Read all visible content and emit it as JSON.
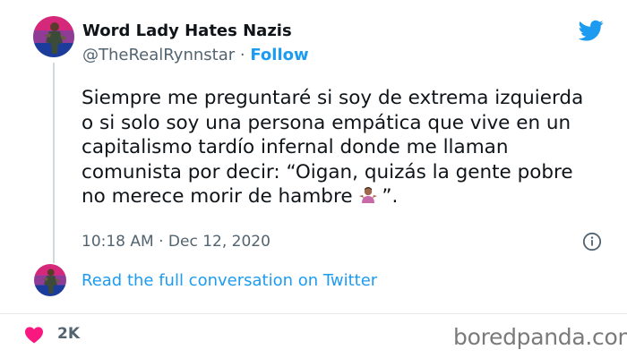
{
  "tweet": {
    "author_name": "Word Lady Hates Nazis",
    "handle": "@TheRealRynnstar",
    "separator": "·",
    "follow_label": "Follow",
    "text_lines": [
      "Siempre me preguntaré si soy de extrema izquierda",
      "o si solo soy una persona empática que vive en un",
      "capitalismo tardío infernal donde me llaman",
      "comunista por decir: “Oigan, quizás la gente pobre",
      "no merece morir de hambre",
      "”."
    ],
    "emoji": "person-shrugging-emoji",
    "timestamp": "10:18 AM · Dec 12, 2020",
    "read_more_label": "Read the full conversation on Twitter",
    "like_count": "2K"
  },
  "icons": {
    "brand": "twitter-bird-icon",
    "info": "info-icon",
    "like": "heart-icon"
  },
  "watermark": "boredpanda.com",
  "colors": {
    "twitter_blue": "#1d9bf0",
    "secondary_text": "#536471",
    "heart": "#f91880",
    "watermark": "#7a7a7a"
  }
}
